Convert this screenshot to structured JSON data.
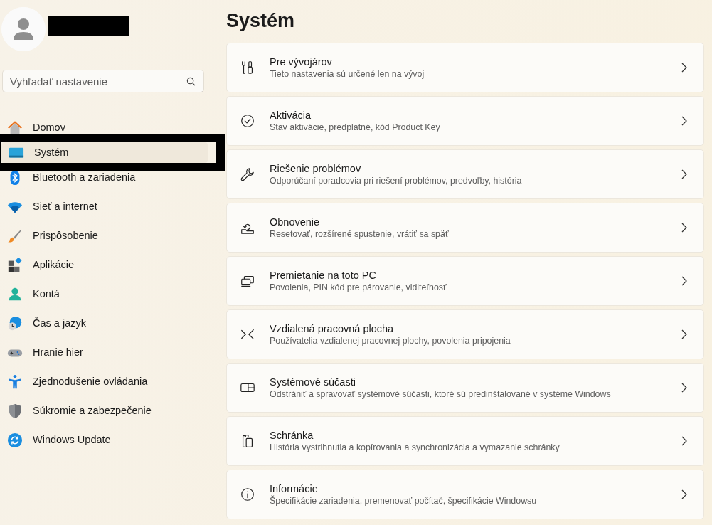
{
  "account": {
    "name_redacted": true
  },
  "search": {
    "placeholder": "Vyhľadať nastavenie"
  },
  "sidebar": {
    "items": [
      {
        "label": "Domov",
        "selected": false,
        "outlined": false
      },
      {
        "label": "Systém",
        "selected": true,
        "outlined": true
      },
      {
        "label": "Bluetooth a zariadenia",
        "selected": false,
        "outlined": false
      },
      {
        "label": "Sieť a internet",
        "selected": false,
        "outlined": false
      },
      {
        "label": "Prispôsobenie",
        "selected": false,
        "outlined": false
      },
      {
        "label": "Aplikácie",
        "selected": false,
        "outlined": false
      },
      {
        "label": "Kontá",
        "selected": false,
        "outlined": false
      },
      {
        "label": "Čas a jazyk",
        "selected": false,
        "outlined": false
      },
      {
        "label": "Hranie hier",
        "selected": false,
        "outlined": false
      },
      {
        "label": "Zjednodušenie ovládania",
        "selected": false,
        "outlined": false
      },
      {
        "label": "Súkromie a zabezpečenie",
        "selected": false,
        "outlined": false
      },
      {
        "label": "Windows Update",
        "selected": false,
        "outlined": false
      }
    ]
  },
  "page": {
    "title": "Systém",
    "settings": [
      {
        "title": "Pre vývojárov",
        "description": "Tieto nastavenia sú určené len na vývoj"
      },
      {
        "title": "Aktivácia",
        "description": "Stav aktivácie, predplatné, kód Product Key"
      },
      {
        "title": "Riešenie problémov",
        "description": "Odporúčaní poradcovia pri riešení problémov, predvoľby, história"
      },
      {
        "title": "Obnovenie",
        "description": "Resetovať, rozšírené spustenie, vrátiť sa späť"
      },
      {
        "title": "Premietanie na toto PC",
        "description": "Povolenia, PIN kód pre párovanie, viditeľnosť"
      },
      {
        "title": "Vzdialená pracovná plocha",
        "description": "Používatelia vzdialenej pracovnej plochy, povolenia pripojenia"
      },
      {
        "title": "Systémové súčasti",
        "description": "Odstrániť a spravovať systémové súčasti, ktoré sú predinštalované v systéme Windows"
      },
      {
        "title": "Schránka",
        "description": "História vystrihnutia a kopírovania a synchronizácia a vymazanie schránky"
      },
      {
        "title": "Informácie",
        "description": "Špecifikácie zariadenia, premenovať počítač, špecifikácie Windowsu"
      }
    ]
  }
}
